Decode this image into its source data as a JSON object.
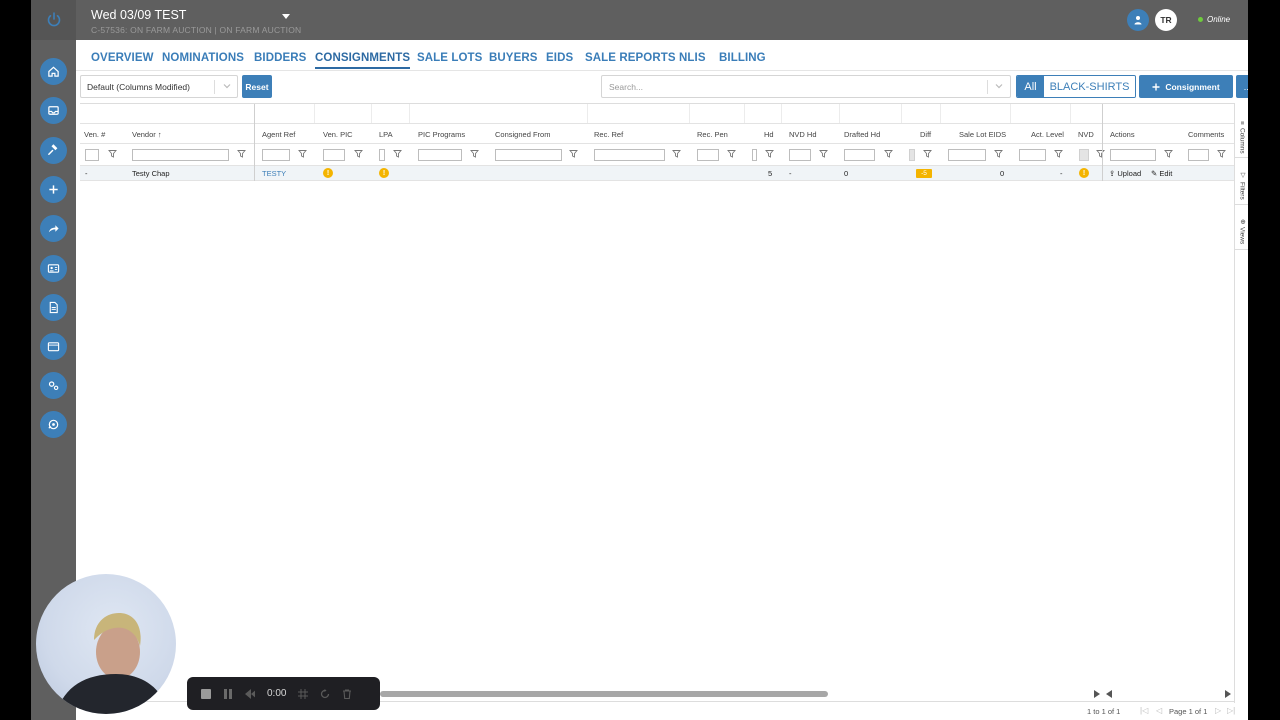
{
  "header": {
    "title": "Wed 03/09 TEST",
    "subtitle": "C-57536: ON FARM AUCTION | ON FARM AUCTION",
    "avatar_initials": "TR",
    "status": "Online"
  },
  "tabs": [
    {
      "label": "OVERVIEW"
    },
    {
      "label": "NOMINATIONS"
    },
    {
      "label": "BIDDERS"
    },
    {
      "label": "CONSIGNMENTS",
      "active": true
    },
    {
      "label": "SALE LOTS"
    },
    {
      "label": "BUYERS"
    },
    {
      "label": "EIDS"
    },
    {
      "label": "SALE REPORTS"
    },
    {
      "label": "NLIS"
    },
    {
      "label": "BILLING"
    }
  ],
  "toolbar": {
    "view_select": "Default (Columns Modified)",
    "reset_label": "Reset",
    "search_placeholder": "Search...",
    "toggle_all": "All",
    "toggle_black_shirts": "BLACK-SHIRTS",
    "add_consignment_label": "Consignment",
    "more_label": "..."
  },
  "columns": [
    {
      "label": "Ven. #"
    },
    {
      "label": "Vendor",
      "sorted": "asc"
    },
    {
      "label": "Agent Ref"
    },
    {
      "label": "Ven. PIC"
    },
    {
      "label": "LPA"
    },
    {
      "label": "PIC Programs"
    },
    {
      "label": "Consigned From"
    },
    {
      "label": "Rec. Ref"
    },
    {
      "label": "Rec. Pen"
    },
    {
      "label": "Hd"
    },
    {
      "label": "NVD Hd"
    },
    {
      "label": "Drafted Hd"
    },
    {
      "label": "Diff"
    },
    {
      "label": "Sale Lot EIDS"
    },
    {
      "label": "Act. Level"
    },
    {
      "label": "NVD"
    },
    {
      "label": "Actions"
    },
    {
      "label": "Comments"
    }
  ],
  "rows": [
    {
      "ven_no": "-",
      "vendor": "Testy Chap",
      "agent_ref": "TESTY",
      "ven_pic_warn": "!",
      "lpa_warn": "!",
      "hd": "5",
      "nvd_hd": "-",
      "drafted_hd": "0",
      "diff": "-5",
      "sale_lot_eids": "0",
      "act_level": "-",
      "nvd_warn": "!",
      "action_upload": "Upload",
      "action_edit": "Edit"
    }
  ],
  "right_panel": {
    "columns": "Columns",
    "filters": "Filters",
    "views": "Views"
  },
  "pagination": {
    "rows_text": "1 to 1 of 1",
    "page_text": "Page 1 of 1"
  },
  "recorder": {
    "time": "0:00"
  },
  "colors": {
    "accent": "#3d7fb8",
    "chrome": "#5f5f5f",
    "warning": "#f4b400"
  }
}
